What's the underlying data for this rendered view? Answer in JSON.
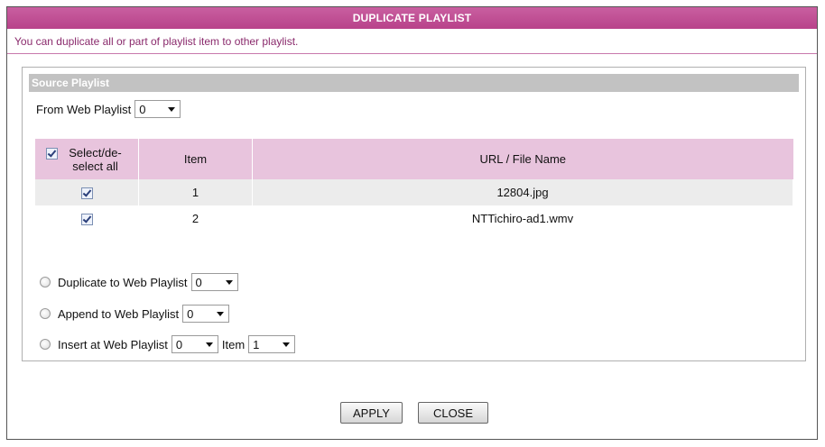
{
  "title": "DUPLICATE PLAYLIST",
  "description": "You can duplicate all or part of playlist item to other playlist.",
  "source": {
    "heading": "Source Playlist",
    "from_label": "From Web Playlist",
    "from_value": "0"
  },
  "table": {
    "headers": {
      "select_all": "Select/de-select all",
      "item": "Item",
      "url": "URL / File Name"
    },
    "rows": [
      {
        "checked": true,
        "item": "1",
        "file": "12804.jpg"
      },
      {
        "checked": true,
        "item": "2",
        "file": "NTTichiro-ad1.wmv"
      }
    ]
  },
  "options": {
    "duplicate_label": "Duplicate to Web Playlist",
    "duplicate_value": "0",
    "append_label": "Append to Web Playlist",
    "append_value": "0",
    "insert_label": "Insert at Web Playlist",
    "insert_value": "0",
    "item_label": "Item",
    "item_value": "1"
  },
  "buttons": {
    "apply": "APPLY",
    "close": "CLOSE"
  },
  "colors": {
    "title_bar": "#b8428a",
    "header_row": "#e8c4dd",
    "description_text": "#8a2a6c",
    "section_head": "#c2c2c2"
  }
}
